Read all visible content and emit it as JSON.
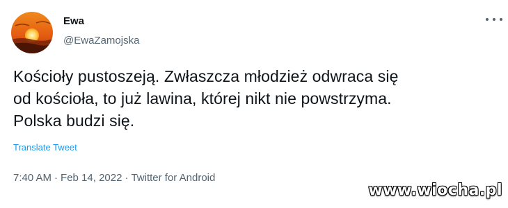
{
  "author": {
    "display_name": "Ewa",
    "handle": "@EwaZamojska"
  },
  "tweet": {
    "text_lines": [
      "Kościoły pustoszeją. Zwłaszcza młodzież odwraca się",
      "od kościoła, to już lawina, której nikt nie powstrzyma.",
      "Polska budzi się."
    ],
    "translate_label": "Translate Tweet",
    "time": "7:40 AM",
    "date": "Feb 14, 2022",
    "source": "Twitter for Android",
    "separator": "·"
  },
  "icons": {
    "more": "more-options-icon",
    "avatar": "sunset-avatar"
  },
  "watermark": "www.wiocha.pl",
  "colors": {
    "text": "#0f1419",
    "secondary": "#536471",
    "link": "#1d9bf0"
  }
}
